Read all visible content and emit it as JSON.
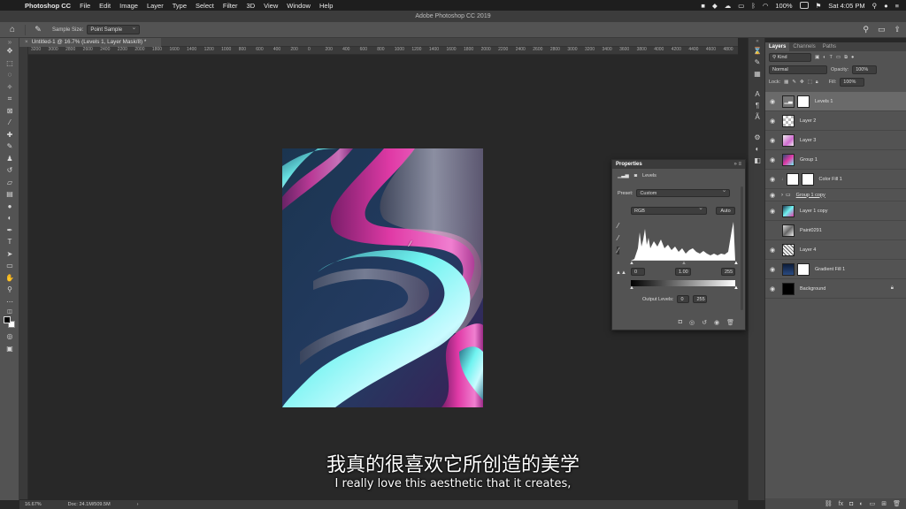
{
  "menubar": {
    "app_name": "Photoshop CC",
    "items": [
      "File",
      "Edit",
      "Image",
      "Layer",
      "Type",
      "Select",
      "Filter",
      "3D",
      "View",
      "Window",
      "Help"
    ],
    "battery": "100%",
    "clock": "Sat 4:05 PM"
  },
  "window_title": "Adobe Photoshop CC 2019",
  "options": {
    "sample_size_label": "Sample Size:",
    "sample_size_value": "Point Sample"
  },
  "document": {
    "tab_label": "Untitled-1 @ 16.7% (Levels 1, Layer Mask/8) *",
    "zoom": "16.67%",
    "doc_info": "Doc: 24.1M/509.5M"
  },
  "ruler": {
    "ticks": [
      "3200",
      "3000",
      "2800",
      "2600",
      "2400",
      "2200",
      "2000",
      "1800",
      "1600",
      "1400",
      "1200",
      "1000",
      "800",
      "600",
      "400",
      "200",
      "0",
      "200",
      "400",
      "600",
      "800",
      "1000",
      "1200",
      "1400",
      "1600",
      "1800",
      "2000",
      "2200",
      "2400",
      "2600",
      "2800",
      "3000",
      "3200",
      "3400",
      "3600",
      "3800",
      "4000",
      "4200",
      "4400",
      "4600",
      "4800"
    ]
  },
  "layers_panel": {
    "tabs": [
      "Layers",
      "Channels",
      "Paths"
    ],
    "filter_value": "Kind",
    "blend_mode": "Normal",
    "opacity_label": "Opacity:",
    "opacity_value": "100%",
    "lock_label": "Lock:",
    "fill_label": "Fill:",
    "fill_value": "100%",
    "layers": [
      {
        "name": "Levels 1",
        "selected": true
      },
      {
        "name": "Layer 2"
      },
      {
        "name": "Layer 3"
      },
      {
        "name": "Group 1"
      },
      {
        "name": "Color Fill 1"
      },
      {
        "name": "Group 1 copy"
      },
      {
        "name": "Layer 1 copy"
      },
      {
        "name": "Paint0291"
      },
      {
        "name": "Layer 4"
      },
      {
        "name": "Gradient Fill 1"
      },
      {
        "name": "Background"
      }
    ]
  },
  "properties": {
    "title": "Properties",
    "adjustment_name": "Levels",
    "preset_label": "Preset:",
    "preset_value": "Custom",
    "channel_value": "RGB",
    "auto_label": "Auto",
    "input_black": "0",
    "input_gamma": "1.00",
    "input_white": "255",
    "output_label": "Output Levels:",
    "output_black": "0",
    "output_white": "255"
  },
  "subtitles": {
    "chinese": "我真的很喜欢它所创造的美学",
    "english": "I really love this aesthetic that it creates,"
  }
}
